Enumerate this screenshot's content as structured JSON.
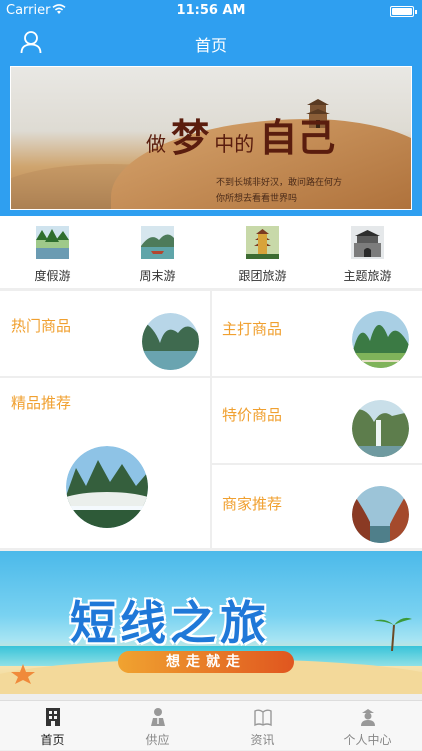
{
  "status_bar": {
    "carrier": "Carrier",
    "time": "11:56 AM"
  },
  "nav": {
    "title": "首页"
  },
  "banner": {
    "slogan_part1": "做",
    "slogan_part2": "梦",
    "slogan_part3": "中的",
    "slogan_part4": "自己",
    "sub1": "不到长城非好汉，敢问路在何方",
    "sub2": "你所想去看看世界吗"
  },
  "categories": [
    {
      "label": "度假游",
      "icon": "forest-lake-thumbnail"
    },
    {
      "label": "周末游",
      "icon": "river-boat-thumbnail"
    },
    {
      "label": "跟团旅游",
      "icon": "pagoda-thumbnail"
    },
    {
      "label": "主题旅游",
      "icon": "city-gate-thumbnail"
    }
  ],
  "products": {
    "hot": "热门商品",
    "featured": "主打商品",
    "recommend": "精品推荐",
    "special": "特价商品",
    "merchant": "商家推荐"
  },
  "promo": {
    "headline": "短线之旅",
    "tagline": "想走就走"
  },
  "tabbar": [
    {
      "label": "首页",
      "icon": "home-building-icon",
      "active": true
    },
    {
      "label": "供应",
      "icon": "supply-person-icon",
      "active": false
    },
    {
      "label": "资讯",
      "icon": "news-book-icon",
      "active": false
    },
    {
      "label": "个人中心",
      "icon": "profile-icon",
      "active": false
    }
  ],
  "colors": {
    "primary": "#2f9ff0",
    "accent": "#f0a030"
  }
}
